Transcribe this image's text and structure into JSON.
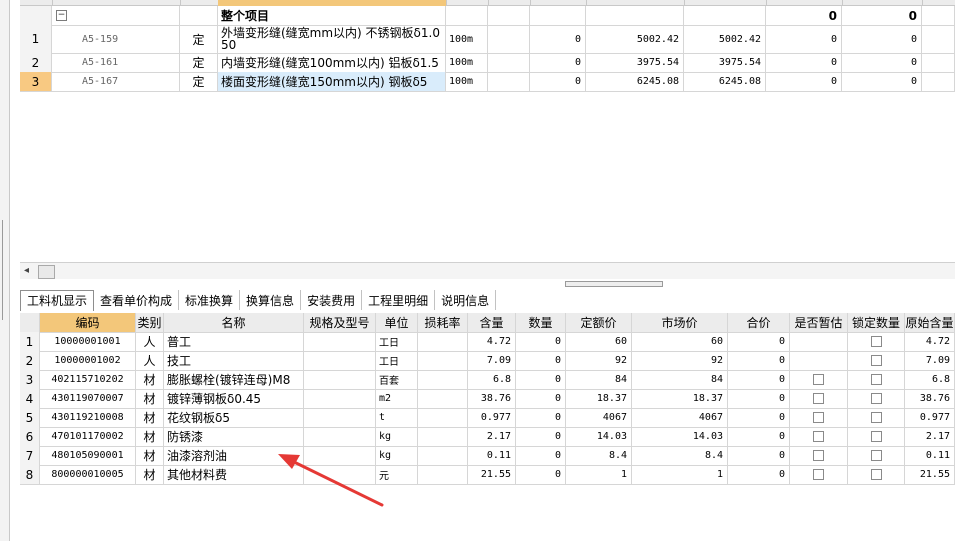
{
  "upper": {
    "group_label": "整个项目",
    "group_sum1": "0",
    "group_sum2": "0",
    "rows": [
      {
        "no": "1",
        "code": "A5-159",
        "type": "定",
        "name_line1": "外墙变形缝(缝宽mm以内) 不锈钢板δ1.0",
        "name_line2": "50",
        "unit": "100m",
        "qty": "0",
        "price1": "5002.42",
        "price2": "5002.42",
        "c1": "0",
        "c2": "0"
      },
      {
        "no": "2",
        "code": "A5-161",
        "type": "定",
        "name_line1": "内墙变形缝(缝宽100mm以内) 铝板δ1.5",
        "name_line2": "",
        "unit": "100m",
        "qty": "0",
        "price1": "3975.54",
        "price2": "3975.54",
        "c1": "0",
        "c2": "0"
      },
      {
        "no": "3",
        "code": "A5-167",
        "type": "定",
        "name_line1": "楼面变形缝(缝宽150mm以内) 钢板δ5",
        "name_line2": "",
        "unit": "100m",
        "qty": "0",
        "price1": "6245.08",
        "price2": "6245.08",
        "c1": "0",
        "c2": "0"
      }
    ]
  },
  "tabs": [
    "工料机显示",
    "查看单价构成",
    "标准换算",
    "换算信息",
    "安装费用",
    "工程里明细",
    "说明信息"
  ],
  "lower": {
    "headers": [
      "编码",
      "类别",
      "名称",
      "规格及型号",
      "单位",
      "损耗率",
      "含量",
      "数量",
      "定额价",
      "市场价",
      "合价",
      "是否暂估",
      "锁定数量",
      "原始含量"
    ],
    "rows": [
      {
        "no": "1",
        "code": "10000001001",
        "cat": "人",
        "name": "普工",
        "spec": "",
        "unit": "工日",
        "loss": "",
        "content": "4.72",
        "qty": "0",
        "base": "60",
        "market": "60",
        "total": "0",
        "est": false,
        "lock": true,
        "orig": "4.72"
      },
      {
        "no": "2",
        "code": "10000001002",
        "cat": "人",
        "name": "技工",
        "spec": "",
        "unit": "工日",
        "loss": "",
        "content": "7.09",
        "qty": "0",
        "base": "92",
        "market": "92",
        "total": "0",
        "est": false,
        "lock": true,
        "orig": "7.09"
      },
      {
        "no": "3",
        "code": "402115710202",
        "cat": "材",
        "name": "膨胀螺栓(镀锌连母)M8",
        "spec": "",
        "unit": "百套",
        "loss": "",
        "content": "6.8",
        "qty": "0",
        "base": "84",
        "market": "84",
        "total": "0",
        "est": true,
        "lock": true,
        "orig": "6.8"
      },
      {
        "no": "4",
        "code": "430119070007",
        "cat": "材",
        "name": "镀锌薄钢板δ0.45",
        "spec": "",
        "unit": "m2",
        "loss": "",
        "content": "38.76",
        "qty": "0",
        "base": "18.37",
        "market": "18.37",
        "total": "0",
        "est": true,
        "lock": true,
        "orig": "38.76"
      },
      {
        "no": "5",
        "code": "430119210008",
        "cat": "材",
        "name": "花纹钢板δ5",
        "spec": "",
        "unit": "t",
        "loss": "",
        "content": "0.977",
        "qty": "0",
        "base": "4067",
        "market": "4067",
        "total": "0",
        "est": true,
        "lock": true,
        "orig": "0.977"
      },
      {
        "no": "6",
        "code": "470101170002",
        "cat": "材",
        "name": "防锈漆",
        "spec": "",
        "unit": "kg",
        "loss": "",
        "content": "2.17",
        "qty": "0",
        "base": "14.03",
        "market": "14.03",
        "total": "0",
        "est": true,
        "lock": true,
        "orig": "2.17"
      },
      {
        "no": "7",
        "code": "480105090001",
        "cat": "材",
        "name": "油漆溶剂油",
        "spec": "",
        "unit": "kg",
        "loss": "",
        "content": "0.11",
        "qty": "0",
        "base": "8.4",
        "market": "8.4",
        "total": "0",
        "est": true,
        "lock": true,
        "orig": "0.11"
      },
      {
        "no": "8",
        "code": "800000010005",
        "cat": "材",
        "name": "其他材料费",
        "spec": "",
        "unit": "元",
        "loss": "",
        "content": "21.55",
        "qty": "0",
        "base": "1",
        "market": "1",
        "total": "0",
        "est": true,
        "lock": true,
        "orig": "21.55"
      }
    ]
  },
  "colors": {
    "header": "#ececec",
    "selected": "#f8c982",
    "name_header": "#f3c77a",
    "arrow": "#e53935"
  }
}
